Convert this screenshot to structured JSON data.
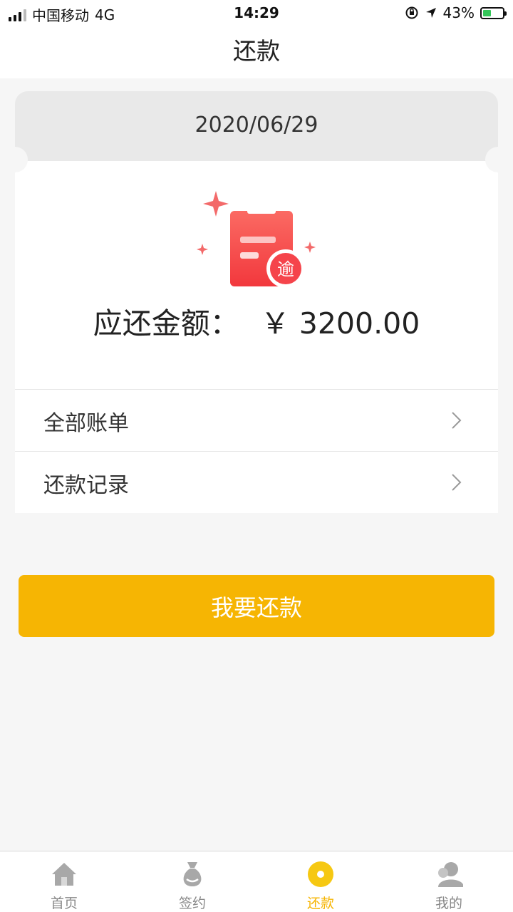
{
  "status_bar": {
    "carrier": "中国移动",
    "network": "4G",
    "time": "14:29",
    "battery": "43%",
    "battery_level": 0.43
  },
  "nav": {
    "title": "还款"
  },
  "repayment": {
    "date": "2020/06/29",
    "badge_char": "逾",
    "amount_label": "应还金额：",
    "amount_value": "￥ 3200.00"
  },
  "menu": [
    {
      "label": "全部账单"
    },
    {
      "label": "还款记录"
    }
  ],
  "cta": {
    "label": "我要还款"
  },
  "tabs": [
    {
      "label": "首页",
      "icon": "home-icon"
    },
    {
      "label": "签约",
      "icon": "money-bag-icon"
    },
    {
      "label": "还款",
      "icon": "coin-icon"
    },
    {
      "label": "我的",
      "icon": "user-icon"
    }
  ],
  "colors": {
    "accent": "#f6b503",
    "overdue_red": "#f5444b",
    "background": "#f6f6f6",
    "card": "#ffffff",
    "date_header": "#e9e9e9"
  }
}
